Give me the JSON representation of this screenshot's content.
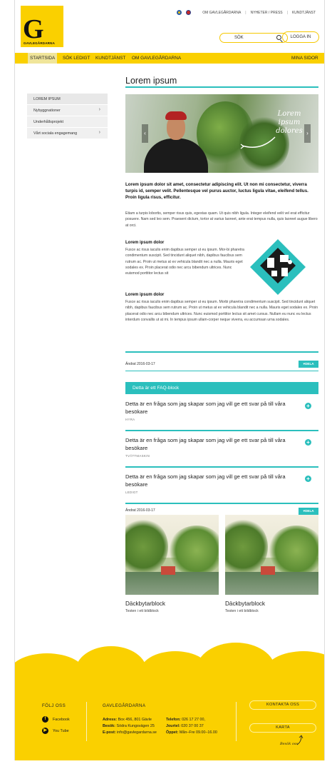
{
  "header": {
    "logo_text": "GAVLEGÅRDARNA",
    "top_links": [
      "OM GAVLEGÅRDARNA",
      "NYHETER / PRESS",
      "KUNDTJÄNST"
    ],
    "search_label": "SÖK",
    "login_label": "LOGGA IN"
  },
  "nav": {
    "items": [
      "STARTSIDA",
      "SÖK LEDIGT",
      "KUNDTJÄNST",
      "OM GAVLEGÅRDARNA"
    ],
    "right": "MINA SIDOR"
  },
  "sidebar": {
    "items": [
      {
        "label": "LOREM IPSUM"
      },
      {
        "label": "Nybyggnationer"
      },
      {
        "label": "Underhållsprojekt"
      },
      {
        "label": "Vårt sociala engagemang"
      }
    ]
  },
  "main": {
    "title": "Lorem ipsum",
    "hero_caption": "Lorem ipsum dolores",
    "lead": "Lorem ipsum dolor sit amet, consectetur adipiscing elit. Ut non mi consectetur, viverra turpis id, semper velit. Pellentesque vel purus auctor, luctus ligula vitae, eleifend tellus. Proin ligula risus, efficitur.",
    "para1": "Etiam a turpis lobortis, semper risus quis, egestas quam. Ut quis nibh ligula. Integer eleifend velit vel erat efficitur posuere. Nam sed leo sem. Praesent dictum, tortor at varius laoreet, ante erat tempus nulla, quis laoreet augue libero at orci.",
    "sub1": "Lorem ipsum dolor",
    "para2": "Fusce ac risus iaculis enim dapibus semper ut eu ipsum. Mor-bi pharetra condimentum suscipit. Sed tincidunt aliquet nibh, dapibus faucibus sem rutrum ac. Proin ut metus at ex vehicula blandit nec a nulla. Mauris eget sodales ex. Proin placerat odio nec arcu bibendum ultrices. Nunc euismod porttitor lectus sit",
    "sub2": "Lorem ipsum dolor",
    "para3": "Fusce ac risus iaculis enim dapibus semper ut eu ipsum. Morbi pharetra condimentum suscipit. Sed tincidunt aliquet nibh, dapibus faucibus sem rutrum ac. Proin ut metus at ex vehicula blandit nec a nulla. Mauris eget sodales ex. Proin placerat odio nec arcu bibendum ultrices. Nunc euismod porttitor lectus sit amet cursus. Nullam eu nunc eu lectus interdum convallis ut at mi. In tempus ipsum ullam-corper neque viverra, eu accumsan urna sodales.",
    "changed": "Ändrat 2016-03-17",
    "share": "DELA"
  },
  "faq": {
    "heading": "Detta är ett FAQ-block",
    "items": [
      {
        "question": "Detta är en fråga som jag skapar som jag vill ge ett svar på till våra besökare",
        "tag": "HYRA"
      },
      {
        "question": "Detta är en fråga som jag skapar som jag vill ge ett svar på till våra besökare",
        "tag": "TVÄTTMASKIN"
      },
      {
        "question": "Detta är en fråga som jag skapar som jag vill ge ett svar på till våra besökare",
        "tag": "LEDIGT"
      }
    ],
    "changed": "Ändrat 2016-03-17",
    "share": "DELA"
  },
  "cards": [
    {
      "title": "Däckbytarblock",
      "subtitle": "Testen i ett bildblock"
    },
    {
      "title": "Däckbytarblock",
      "subtitle": "Testen i ett bildblock"
    }
  ],
  "footer": {
    "follow": "FÖLJ OSS",
    "facebook": "Facebook",
    "youtube": "You Tube",
    "company": "GAVLEGÅRDARNA",
    "address_label": "Adress:",
    "address": "Box 456, 801 Gävle",
    "visit_label": "Besök:",
    "visit": "Södra Kungsvägen 25",
    "email_label": "E-post:",
    "email": "info@gavlegardarna.se",
    "phone_label": "Telefon:",
    "phone": "026 17 27 00,",
    "emergency_label": "Jourtel:",
    "emergency": "020 37 00 37",
    "hours_label": "Öppet:",
    "hours": "Mån–Fre 09.00–16.00",
    "contact_btn": "KONTAKTA OSS",
    "map_btn": "KARTA",
    "visit_us": "Besök oss"
  },
  "colors": {
    "brand_yellow": "#fad000",
    "accent_teal": "#2bbfbd"
  }
}
